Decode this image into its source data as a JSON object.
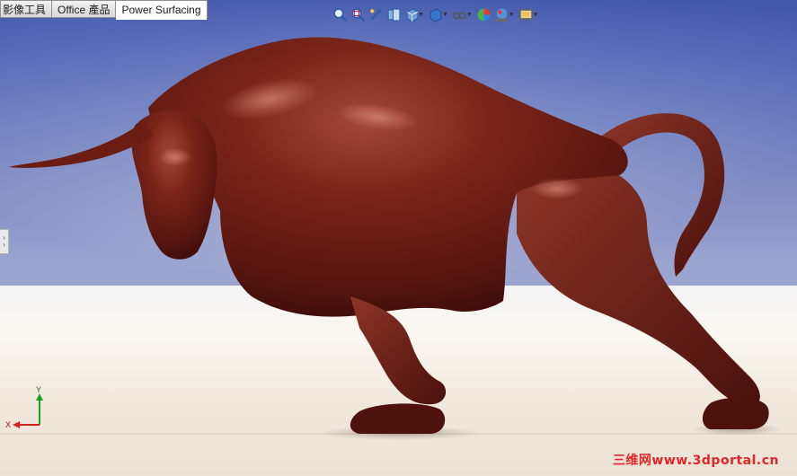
{
  "tabs": [
    {
      "label": "影像工具"
    },
    {
      "label": "Office 產品"
    },
    {
      "label": "Power Surfacing",
      "active": true
    }
  ],
  "toolbar": {
    "icons": [
      "zoom-to-fit-icon",
      "zoom-area-icon",
      "previous-view-icon",
      "section-view-icon",
      "view-orientation-icon",
      "display-style-icon",
      "hide-show-icon",
      "appearance-icon",
      "scene-icon",
      "view-settings-icon"
    ]
  },
  "triad": {
    "x_label": "X",
    "y_label": "Y"
  },
  "watermark": {
    "text": "三维网www.3dportal.cn"
  },
  "colors": {
    "model": "#6b1d14",
    "background_top": "#4b5fb0",
    "floor": "#efe6da",
    "watermark": "#e0262a"
  }
}
